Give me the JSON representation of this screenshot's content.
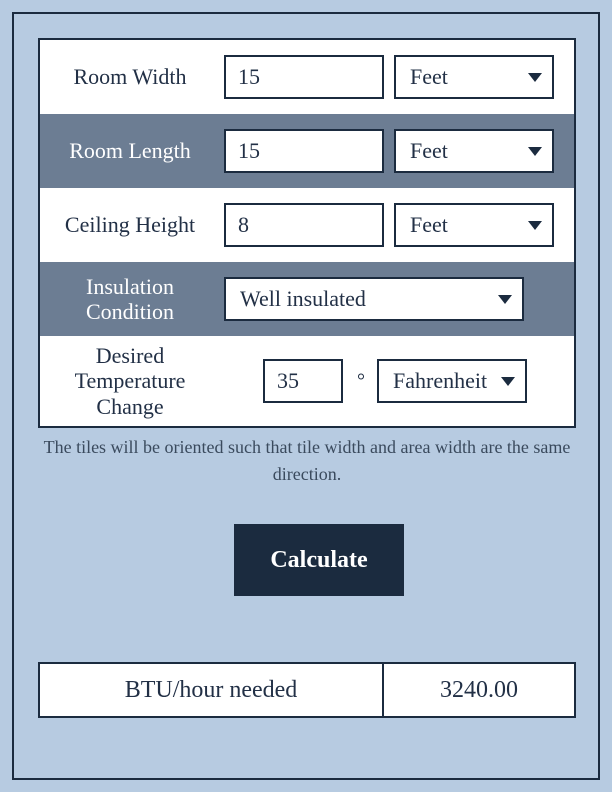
{
  "form": {
    "room_width": {
      "label": "Room Width",
      "value": "15",
      "unit": "Feet"
    },
    "room_length": {
      "label": "Room Length",
      "value": "15",
      "unit": "Feet"
    },
    "ceiling_height": {
      "label": "Ceiling Height",
      "value": "8",
      "unit": "Feet"
    },
    "insulation": {
      "label": "Insulation Condition",
      "value": "Well insulated"
    },
    "temp_change": {
      "label": "Desired Temperature Change",
      "value": "35",
      "degree": "°",
      "unit": "Fahrenheit"
    }
  },
  "note": "The tiles will be oriented such that tile width and area width are the same direction.",
  "calculate_label": "Calculate",
  "result": {
    "label": "BTU/hour needed",
    "value": "3240.00"
  }
}
